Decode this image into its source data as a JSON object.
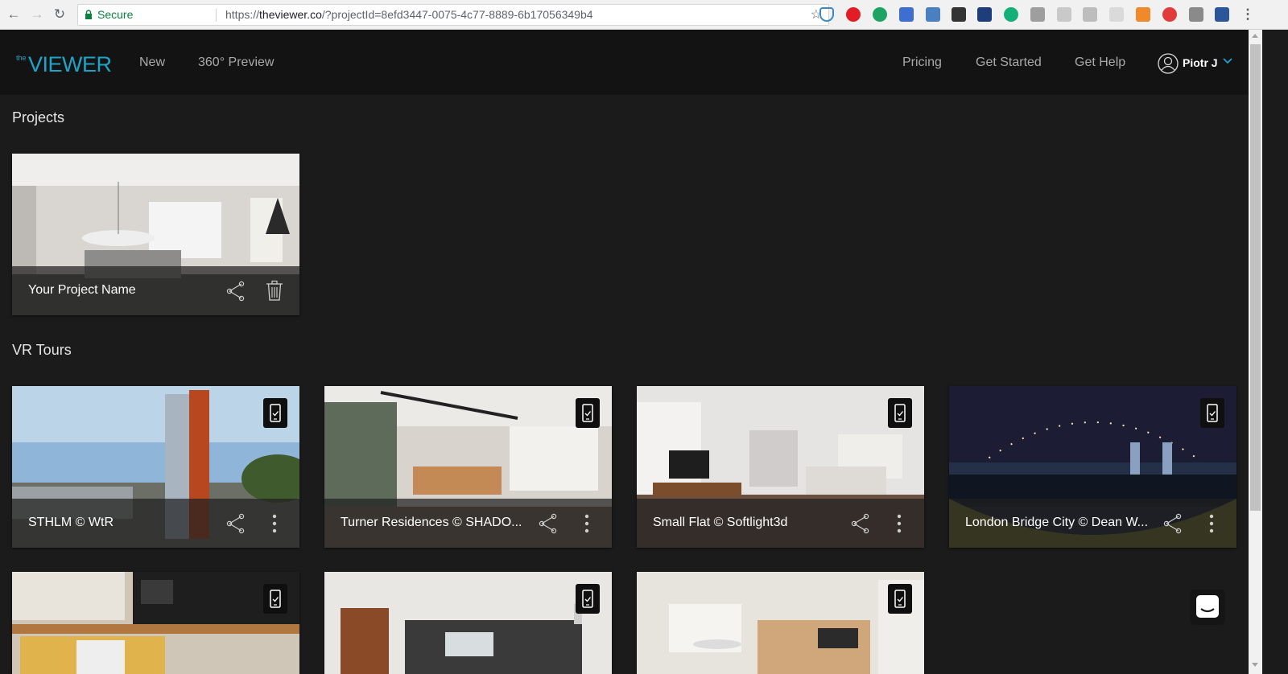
{
  "browser": {
    "secure_label": "Secure",
    "url_prefix": "https://",
    "url_host": "theviewer.co",
    "url_rest": "/?projectId=8efd3447-0075-4c77-8889-6b17056349b4"
  },
  "header": {
    "logo_small": "the",
    "logo_main": "VIEWER",
    "nav_left": [
      "New",
      "360° Preview"
    ],
    "nav_right": [
      "Pricing",
      "Get Started",
      "Get Help"
    ],
    "user_name": "Piotr J"
  },
  "projects": {
    "heading": "Projects",
    "items": [
      {
        "title": "Your Project Name"
      }
    ]
  },
  "vr_tours": {
    "heading": "VR Tours",
    "items": [
      {
        "title": "STHLM © WtR"
      },
      {
        "title": "Turner Residences © SHADO..."
      },
      {
        "title": "Small Flat © Softlight3d"
      },
      {
        "title": "London Bridge City © Dean W..."
      }
    ]
  },
  "colors": {
    "accent": "#1ea4c8",
    "background": "#1b1b1b",
    "header": "#131313"
  },
  "icons": [
    "back-icon",
    "forward-icon",
    "reload-icon",
    "lock-icon",
    "star-icon",
    "user-icon",
    "chevron-down-icon",
    "share-icon",
    "trash-icon",
    "more-icon",
    "mobile-vr-icon",
    "chat-icon"
  ]
}
